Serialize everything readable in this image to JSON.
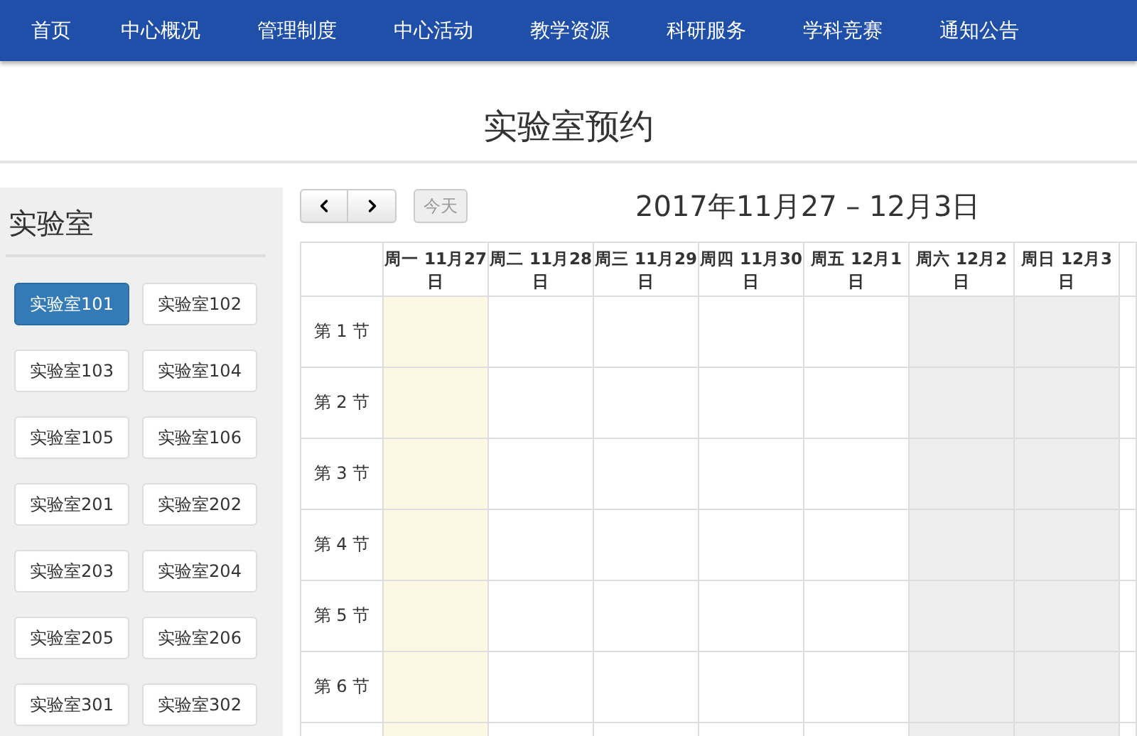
{
  "nav": [
    {
      "label": "首页"
    },
    {
      "label": "中心概况"
    },
    {
      "label": "管理制度"
    },
    {
      "label": "中心活动"
    },
    {
      "label": "教学资源"
    },
    {
      "label": "科研服务"
    },
    {
      "label": "学科竞赛"
    },
    {
      "label": "通知公告"
    }
  ],
  "page_title": "实验室预约",
  "sidebar": {
    "title": "实验室",
    "labs": [
      {
        "label": "实验室101",
        "selected": true
      },
      {
        "label": "实验室102",
        "selected": false
      },
      {
        "label": "实验室103",
        "selected": false
      },
      {
        "label": "实验室104",
        "selected": false
      },
      {
        "label": "实验室105",
        "selected": false
      },
      {
        "label": "实验室106",
        "selected": false
      },
      {
        "label": "实验室201",
        "selected": false
      },
      {
        "label": "实验室202",
        "selected": false
      },
      {
        "label": "实验室203",
        "selected": false
      },
      {
        "label": "实验室204",
        "selected": false
      },
      {
        "label": "实验室205",
        "selected": false
      },
      {
        "label": "实验室206",
        "selected": false
      },
      {
        "label": "实验室301",
        "selected": false
      },
      {
        "label": "实验室302",
        "selected": false
      }
    ]
  },
  "calendar": {
    "today_button": {
      "label": "今天",
      "disabled": true
    },
    "range_title": "2017年11月27 – 12月3日",
    "days": [
      {
        "label": "周一 11月27日",
        "kind": "today"
      },
      {
        "label": "周二 11月28日",
        "kind": "weekday"
      },
      {
        "label": "周三 11月29日",
        "kind": "weekday"
      },
      {
        "label": "周四 11月30日",
        "kind": "weekday"
      },
      {
        "label": "周五 12月1日",
        "kind": "weekday"
      },
      {
        "label": "周六 12月2日",
        "kind": "weekend"
      },
      {
        "label": "周日 12月3日",
        "kind": "weekend"
      }
    ],
    "slots": [
      {
        "label": "第 1 节"
      },
      {
        "label": "第 2 节"
      },
      {
        "label": "第 3 节"
      },
      {
        "label": "第 4 节"
      },
      {
        "label": "第 5 节"
      },
      {
        "label": "第 6 节"
      }
    ]
  }
}
